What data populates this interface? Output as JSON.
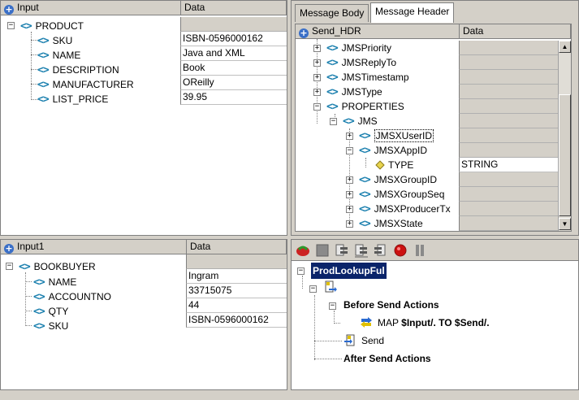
{
  "input_pane": {
    "col_name": "Input",
    "col_data": "Data",
    "root": "PRODUCT",
    "rows": [
      {
        "name": "SKU",
        "value": "ISBN-0596000162"
      },
      {
        "name": "NAME",
        "value": "Java and XML"
      },
      {
        "name": "DESCRIPTION",
        "value": "Book"
      },
      {
        "name": "MANUFACTURER",
        "value": "OReilly"
      },
      {
        "name": "LIST_PRICE",
        "value": "39.95"
      }
    ]
  },
  "input1_pane": {
    "col_name": "Input1",
    "col_data": "Data",
    "root": "BOOKBUYER",
    "rows": [
      {
        "name": "NAME",
        "value": "Ingram"
      },
      {
        "name": "ACCOUNTNO",
        "value": "33715075"
      },
      {
        "name": "QTY",
        "value": "44"
      },
      {
        "name": "SKU",
        "value": "ISBN-0596000162"
      }
    ]
  },
  "message_pane": {
    "tabs": [
      "Message Body",
      "Message Header"
    ],
    "active_tab": 1,
    "col_name": "Send_HDR",
    "col_data": "Data",
    "rows": [
      {
        "name": "JMSPriority",
        "value": ""
      },
      {
        "name": "JMSReplyTo",
        "value": ""
      },
      {
        "name": "JMSTimestamp",
        "value": ""
      },
      {
        "name": "JMSType",
        "value": ""
      },
      {
        "name": "PROPERTIES",
        "value": ""
      },
      {
        "name": "JMS",
        "value": ""
      },
      {
        "name": "JMSXUserID",
        "value": ""
      },
      {
        "name": "JMSXAppID",
        "value": ""
      },
      {
        "name": "TYPE",
        "value": "STRING"
      },
      {
        "name": "JMSXGroupID",
        "value": ""
      },
      {
        "name": "JMSXGroupSeq",
        "value": ""
      },
      {
        "name": "JMSXProducerTx",
        "value": ""
      },
      {
        "name": "JMSXState",
        "value": ""
      }
    ]
  },
  "flow_pane": {
    "toolbar": [
      "run-icon",
      "stop-icon",
      "step-icon",
      "step-into-icon",
      "step-over-icon",
      "breakpoint-icon",
      "pause-icon"
    ],
    "root": "ProdLookupFul",
    "before": "Before Send Actions",
    "map_prefix": "MAP",
    "map_expr": "$Input/. TO $Send/.",
    "send": "Send",
    "after": "After Send Actions"
  },
  "colors": {
    "selection": "#0a246a",
    "tag": "#1a7fae",
    "toolbar_bg": "#d4d0c8"
  }
}
